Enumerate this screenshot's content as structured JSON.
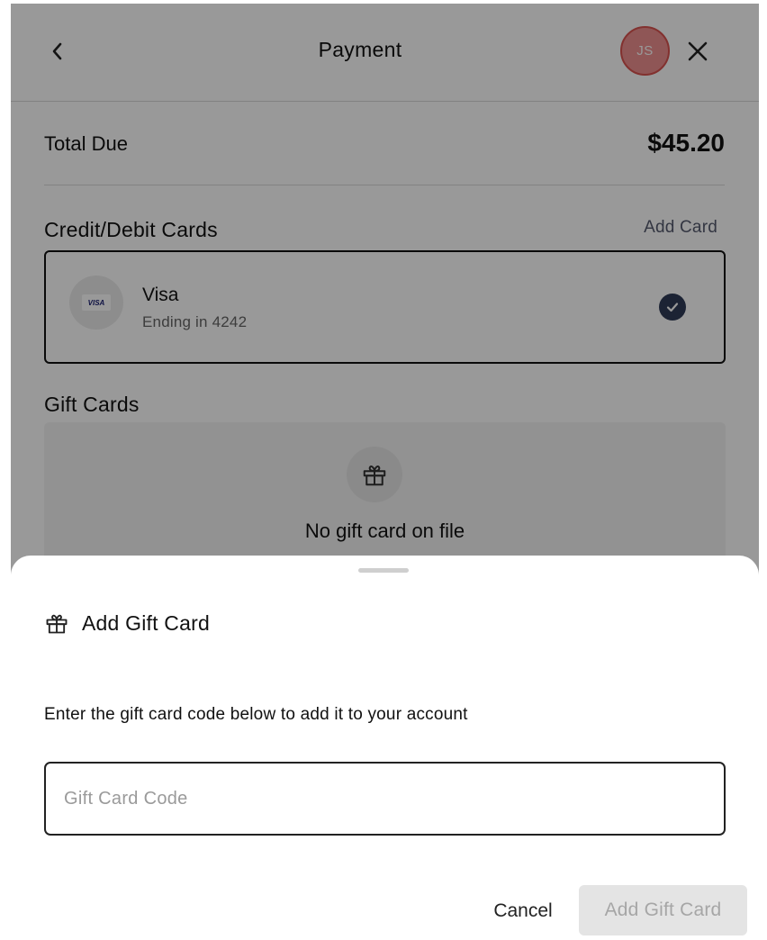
{
  "header": {
    "title": "Payment",
    "avatar_initials": "JS",
    "icons": {
      "back": "chevron-left-icon",
      "close": "close-icon"
    }
  },
  "summary": {
    "total_label": "Total Due",
    "total_amount": "$45.20"
  },
  "cards_section": {
    "title": "Credit/Debit Cards",
    "add_link": "Add Card",
    "card": {
      "brand_badge": "VISA",
      "name": "Visa",
      "subtitle": "Ending in 4242",
      "selected": true
    }
  },
  "gift_section": {
    "title": "Gift Cards",
    "empty_title": "No gift card on file",
    "icon": "gift-icon"
  },
  "sheet": {
    "title": "Add Gift Card",
    "icon": "gift-icon",
    "description": "Enter the gift card code below to add it to your account",
    "input_placeholder": "Gift Card Code",
    "input_value": "",
    "cancel_label": "Cancel",
    "submit_label": "Add Gift Card"
  },
  "colors": {
    "avatar_bg": "#ef8f8f",
    "check_bg": "#2f3b57",
    "disabled_button_bg": "#e4e4e4"
  }
}
